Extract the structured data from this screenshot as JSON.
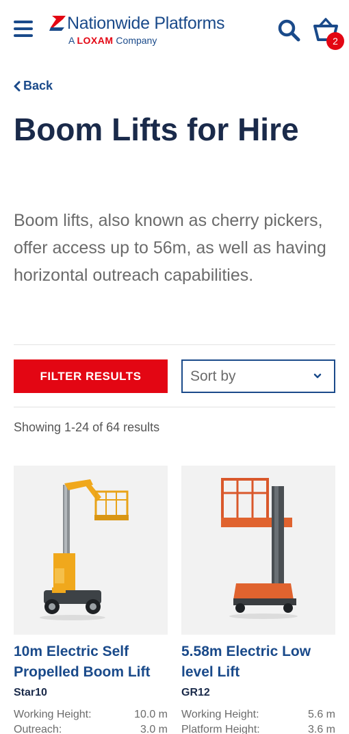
{
  "brand": {
    "name": "Nationwide Platforms",
    "tagline_prefix": "A",
    "tagline_brand": "LOXAM",
    "tagline_suffix": "Company"
  },
  "header": {
    "menu_icon": "hamburger-icon",
    "search_icon": "search-icon",
    "cart_icon": "basket-icon",
    "cart_count": "2"
  },
  "back": {
    "label": "Back"
  },
  "page": {
    "title": "Boom Lifts for Hire",
    "intro": "Boom lifts, also known as cherry pickers, offer access up to 56m, as well as having horizontal outreach capabilities."
  },
  "controls": {
    "filter_label": "FILTER RESULTS",
    "sort_label": "Sort by"
  },
  "results": {
    "count_text": "Showing 1-24 of 64 results"
  },
  "products": [
    {
      "title": "10m Electric Self Propelled Boom Lift",
      "model": "Star10",
      "specs": [
        {
          "label": "Working Height:",
          "value": "10.0 m"
        },
        {
          "label": "Outreach:",
          "value": "3.0 m"
        }
      ]
    },
    {
      "title": "5.58m Electric Low level Lift",
      "model": "GR12",
      "specs": [
        {
          "label": "Working Height:",
          "value": "5.6 m"
        },
        {
          "label": "Platform Height:",
          "value": "3.6 m"
        }
      ]
    }
  ],
  "colors": {
    "brand_blue": "#1a4a8a",
    "navy": "#1a2a4a",
    "accent_red": "#e30613"
  }
}
